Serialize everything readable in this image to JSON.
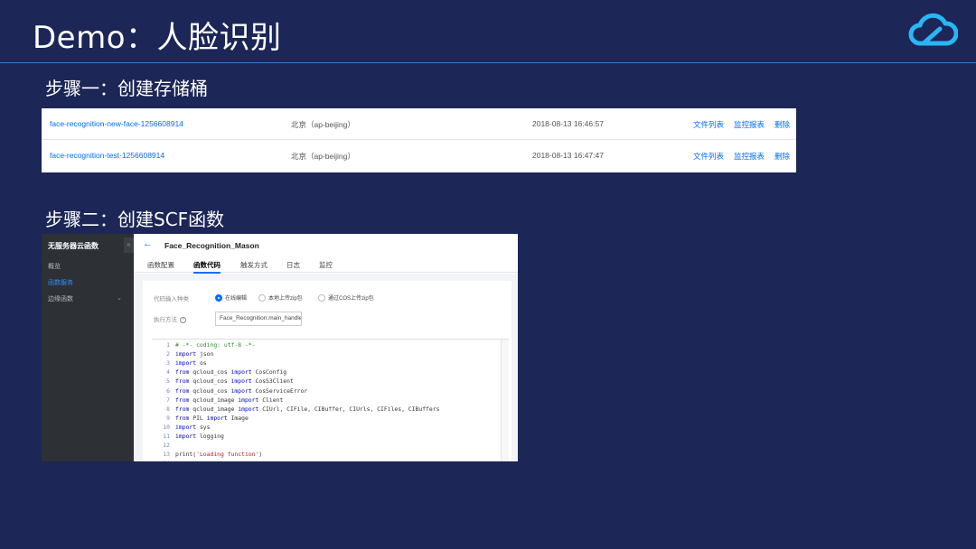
{
  "slide": {
    "title": "Demo：人脸识别",
    "step1_title": "步骤一：创建存储桶",
    "step2_title": "步骤二：创建SCF函数"
  },
  "buckets": [
    {
      "name": "face-recognition-new-face-1256608914",
      "region": "北京（ap-beijing）",
      "created": "2018-08-13 16:46:57",
      "actions": [
        "文件列表",
        "监控报表",
        "删除"
      ]
    },
    {
      "name": "face-recognition-test-1256608914",
      "region": "北京（ap-beijing）",
      "created": "2018-08-13 16:47:47",
      "actions": [
        "文件列表",
        "监控报表",
        "删除"
      ]
    }
  ],
  "console": {
    "sidebar": {
      "title": "无服务器云函数",
      "collapse": "«",
      "items": [
        "概览",
        "函数服务",
        "边缘函数"
      ]
    },
    "function_name": "Face_Recognition_Mason",
    "tabs": [
      "函数配置",
      "函数代码",
      "触发方式",
      "日志",
      "监控"
    ],
    "active_tab": "函数代码",
    "form": {
      "input_type_label": "代码输入种类",
      "input_type_options": [
        "在线编辑",
        "本地上传zip包",
        "通过COS上传zip包"
      ],
      "selected_option": "在线编辑",
      "handler_label": "执行方法",
      "handler_value": "Face_Recognition.main_handler"
    },
    "code_lines": [
      "# -*- coding: utf-8 -*-",
      "import json",
      "import os",
      "from qcloud_cos import CosConfig",
      "from qcloud_cos import CosS3Client",
      "from qcloud_cos import CosServiceError",
      "from qcloud_image import Client",
      "from qcloud_image import CIUrl, CIFile, CIBuffer, CIUrls, CIFiles, CIBuffers",
      "from PIL import Image",
      "import sys",
      "import logging",
      "",
      "print('Loading function')",
      ""
    ]
  },
  "colors": {
    "background": "#1c2657",
    "header_rule": "#3f78c8",
    "link": "#006eff",
    "logo": "#29b6f6"
  },
  "icons": [
    "tencent-cloud-logo-icon",
    "back-arrow-icon",
    "chevron-down-icon",
    "info-icon",
    "radio-icon"
  ]
}
